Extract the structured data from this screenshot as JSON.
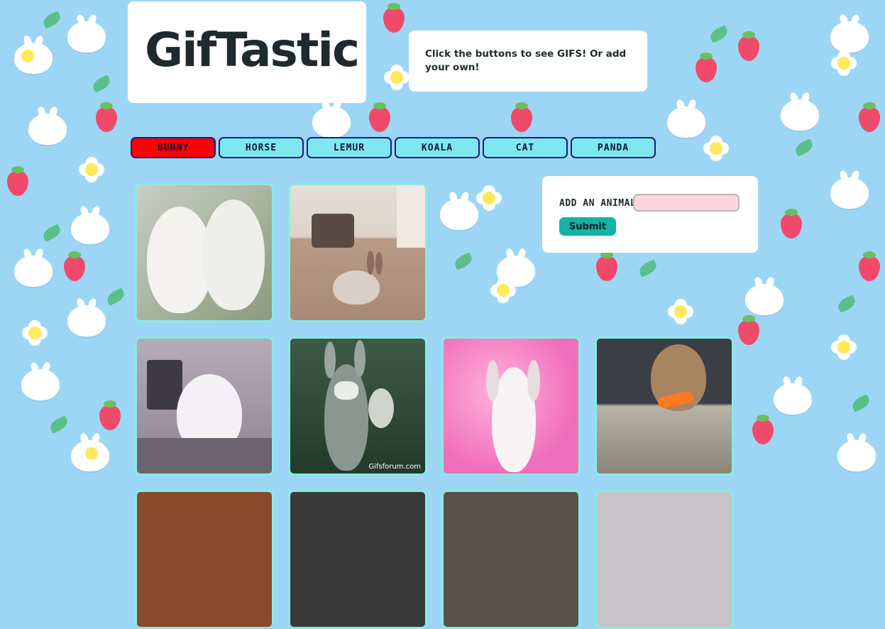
{
  "header": {
    "title": "GifTastic"
  },
  "instructions": {
    "text": "Click the buttons to see GIFS! Or add your own!"
  },
  "animal_buttons": [
    {
      "label": "bunny",
      "active": true
    },
    {
      "label": "horse",
      "active": false
    },
    {
      "label": "lemur",
      "active": false
    },
    {
      "label": "koala",
      "active": false
    },
    {
      "label": "cat",
      "active": false
    },
    {
      "label": "panda",
      "active": false
    }
  ],
  "form": {
    "label": "ADD AN ANIMAL",
    "input_value": "",
    "submit_label": "Submit"
  },
  "gifs": [
    {
      "subject": "two fluffy white bunnies"
    },
    {
      "subject": "brown bunny on carpet"
    },
    {
      "subject": "white bunny at computer"
    },
    {
      "subject": "bugs bunny costume",
      "caption": "Gifsforum.com"
    },
    {
      "subject": "white lop bunny on pink sparkles"
    },
    {
      "subject": "brown bunny eating carrot"
    },
    {
      "subject": "partially visible gif"
    },
    {
      "subject": "partially visible gif"
    },
    {
      "subject": "partially visible gif"
    },
    {
      "subject": "partially visible gif"
    }
  ],
  "colors": {
    "background": "#9dd6f4",
    "button_default": "#7fe7ef",
    "button_active": "#ff0000",
    "button_border": "#1d1a8a",
    "submit": "#13b3a7",
    "input_bg": "#ffd4dd",
    "gif_border": "#86ece4"
  }
}
